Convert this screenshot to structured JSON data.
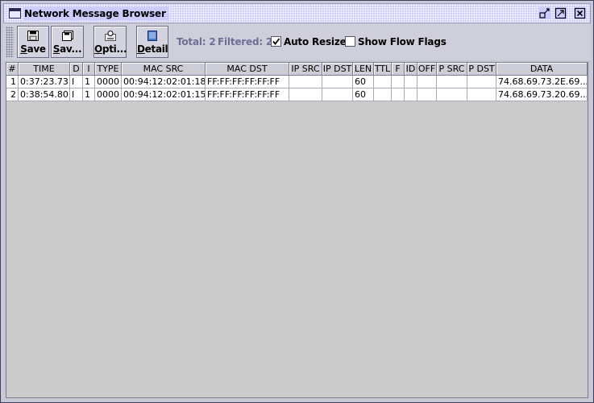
{
  "window": {
    "title": "Network Message Browser"
  },
  "toolbar": {
    "buttons": [
      {
        "label": "Save",
        "mnemonic": "S",
        "rest": "ave",
        "icon": "floppy-disk-icon"
      },
      {
        "label": "Sav...",
        "mnemonic": "S",
        "rest": "av...",
        "icon": "floppy-disk-multiple-icon"
      },
      {
        "label": "Opti...",
        "mnemonic": "O",
        "rest": "pti...",
        "icon": "options-icon"
      },
      {
        "label": "Detail",
        "mnemonic": "D",
        "rest": "etail",
        "icon": "detail-document-icon"
      }
    ],
    "total": "Total: 2",
    "filtered": "Filtered: 2",
    "auto_resize": {
      "label": "Auto Resize",
      "checked": true
    },
    "show_flow_flags": {
      "label": "Show Flow Flags",
      "checked": false
    }
  },
  "table": {
    "columns": [
      "#",
      "TIME",
      "D",
      "I",
      "TYPE",
      "MAC SRC",
      "MAC DST",
      "IP SRC",
      "IP DST",
      "LEN",
      "TTL",
      "F",
      "ID",
      "OFF",
      "P SRC",
      "P DST",
      "DATA"
    ],
    "rows": [
      [
        "1",
        "0:37:23.73",
        "I",
        "1",
        "0000",
        "00:94:12:02:01:18",
        "FF:FF:FF:FF:FF:FF",
        "",
        "",
        "60",
        "",
        "",
        "",
        "",
        "",
        "",
        "74.68.69.73.2E.69..."
      ],
      [
        "2",
        "0:38:54.80",
        "I",
        "1",
        "0000",
        "00:94:12:02:01:15",
        "FF:FF:FF:FF:FF:FF",
        "",
        "",
        "60",
        "",
        "",
        "",
        "",
        "",
        "",
        "74.68.69.73.20.69..."
      ]
    ]
  },
  "colors": {
    "title_bar": "#ccccff",
    "stat_text": "#6e6e96"
  }
}
